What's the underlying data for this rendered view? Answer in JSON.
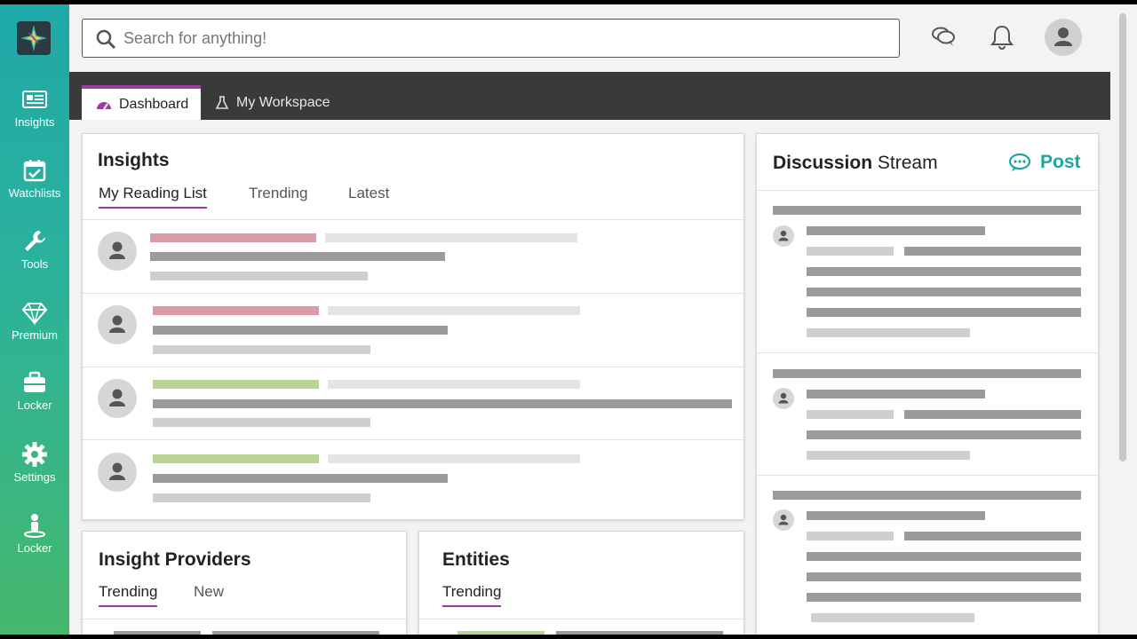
{
  "search": {
    "placeholder": "Search for anything!"
  },
  "sidebar": {
    "items": [
      {
        "label": "Insights",
        "icon": "newspaper-icon"
      },
      {
        "label": "Watchlists",
        "icon": "calendar-check-icon"
      },
      {
        "label": "Tools",
        "icon": "wrench-icon"
      },
      {
        "label": "Premium",
        "icon": "diamond-icon"
      },
      {
        "label": "Locker",
        "icon": "briefcase-icon"
      },
      {
        "label": "Settings",
        "icon": "gear-icon"
      },
      {
        "label": "Locker",
        "icon": "person-pin-icon"
      }
    ]
  },
  "tabs": [
    {
      "label": "Dashboard",
      "icon": "gauge-icon",
      "active": true
    },
    {
      "label": "My Workspace",
      "icon": "flask-icon",
      "active": false
    }
  ],
  "insights": {
    "title": "Insights",
    "subtabs": [
      "My Reading List",
      "Trending",
      "Latest"
    ]
  },
  "discussion": {
    "title_bold": "Discussion",
    "title_rest": " Stream",
    "post_label": "Post"
  },
  "providers": {
    "title": "Insight Providers",
    "subtabs": [
      "Trending",
      "New"
    ]
  },
  "entities": {
    "title": "Entities",
    "subtabs": [
      "Trending"
    ]
  },
  "colors": {
    "accent_teal": "#1fa5a0",
    "accent_purple": "#9a3ea0",
    "tabs_bar": "#3a3a3a"
  }
}
